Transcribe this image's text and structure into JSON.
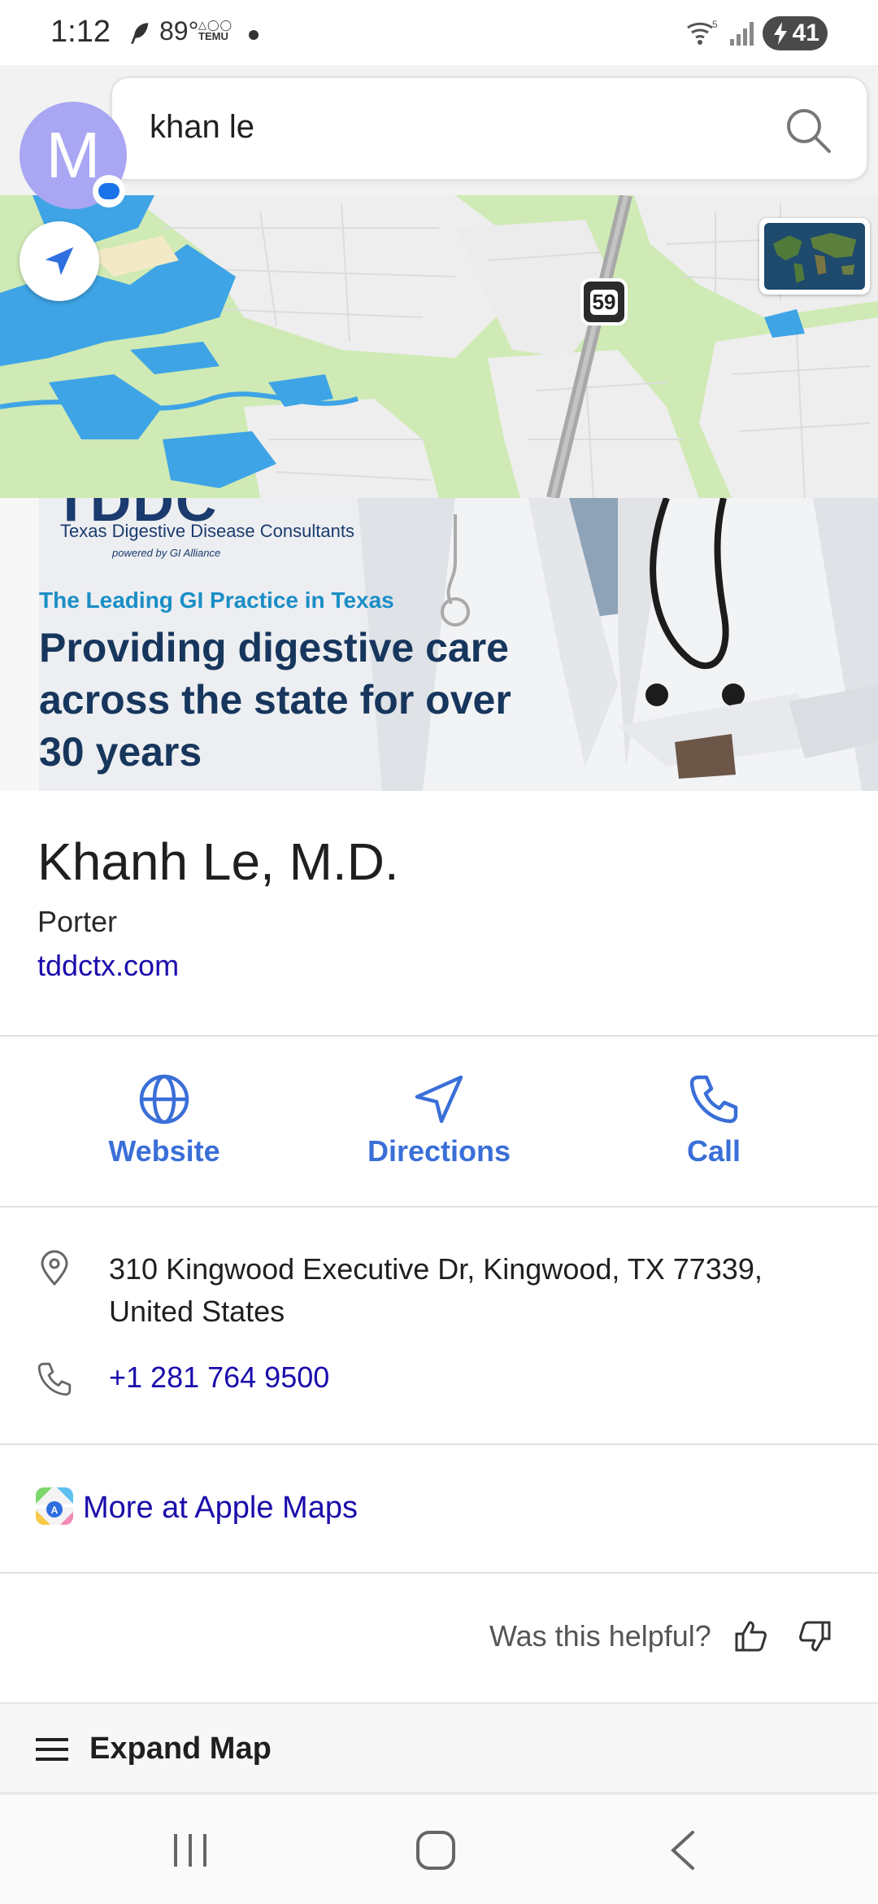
{
  "status_bar": {
    "time": "1:12",
    "temperature": "89°",
    "notification_app": "TEMU",
    "wifi_badge": "5",
    "battery_level": "41"
  },
  "search": {
    "query": "khan le",
    "avatar_letter": "M"
  },
  "map": {
    "highway_shield": "59",
    "colors": {
      "land": "#cfeab4",
      "water": "#3fa4e6",
      "road": "#a8a8a8",
      "urban": "#eeeeee"
    }
  },
  "banner": {
    "logo_subtitle": "Texas Digestive Disease Consultants",
    "logo_powered": "powered by GI Alliance",
    "eyebrow": "The Leading GI Practice in Texas",
    "headline": "Providing digestive care across the state for over 30 years"
  },
  "place": {
    "name": "Khanh Le, M.D.",
    "locality": "Porter",
    "website": "tddctx.com"
  },
  "actions": {
    "website": "Website",
    "directions": "Directions",
    "call": "Call"
  },
  "details": {
    "address": "310 Kingwood Executive Dr, Kingwood, TX 77339, United States",
    "phone": "+1 281 764 9500"
  },
  "more_link": "More at Apple Maps",
  "feedback": {
    "question": "Was this helpful?"
  },
  "expand_map": "Expand Map",
  "colors": {
    "accent": "#3a6fd8",
    "link": "#1a0dab"
  }
}
